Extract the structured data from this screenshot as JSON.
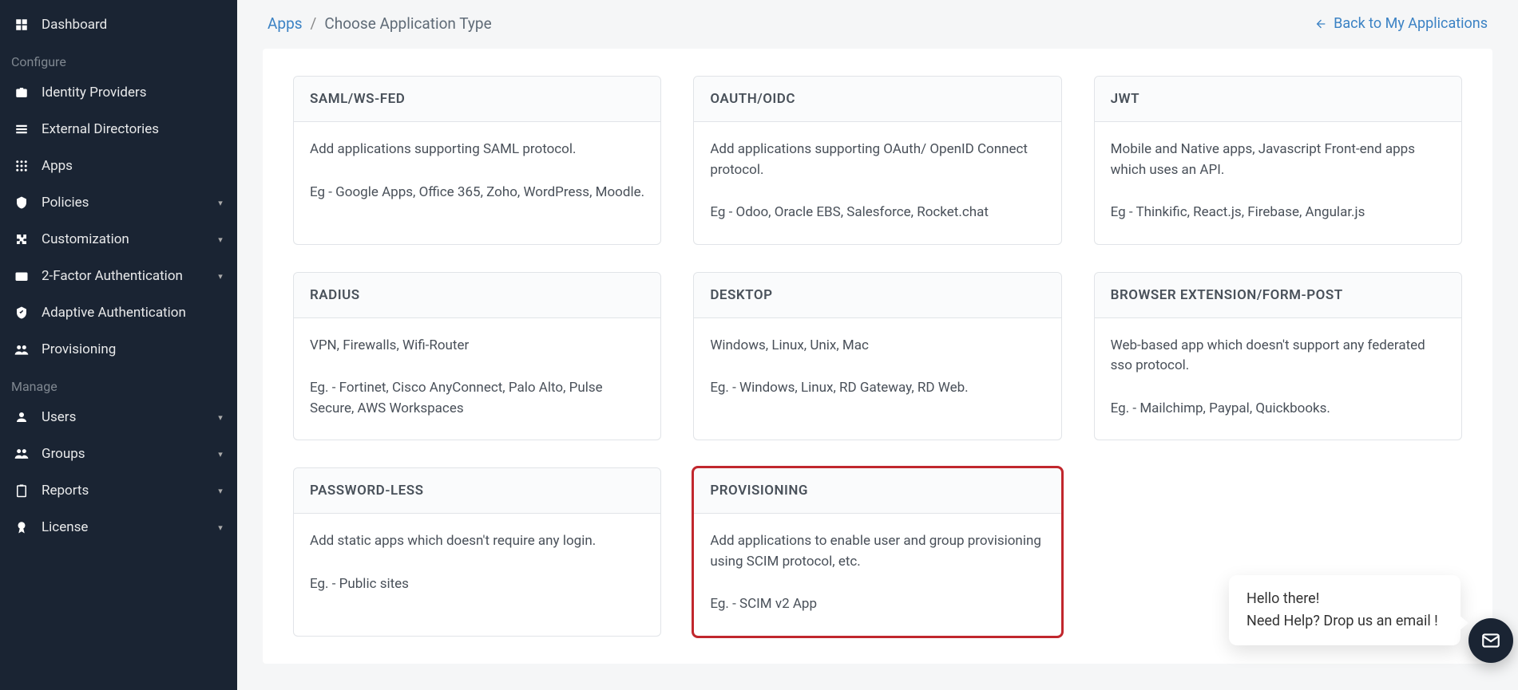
{
  "sidebar": {
    "items_top": [
      {
        "label": "Dashboard"
      }
    ],
    "section_configure": "Configure",
    "items_configure": [
      {
        "label": "Identity Providers",
        "expandable": false
      },
      {
        "label": "External Directories",
        "expandable": false
      },
      {
        "label": "Apps",
        "expandable": false
      },
      {
        "label": "Policies",
        "expandable": true
      },
      {
        "label": "Customization",
        "expandable": true
      },
      {
        "label": "2-Factor Authentication",
        "expandable": true
      },
      {
        "label": "Adaptive Authentication",
        "expandable": false
      },
      {
        "label": "Provisioning",
        "expandable": false
      }
    ],
    "section_manage": "Manage",
    "items_manage": [
      {
        "label": "Users",
        "expandable": true
      },
      {
        "label": "Groups",
        "expandable": true
      },
      {
        "label": "Reports",
        "expandable": true
      },
      {
        "label": "License",
        "expandable": true
      }
    ]
  },
  "breadcrumb": {
    "root": "Apps",
    "sep": "/",
    "current": "Choose Application Type"
  },
  "back_link": "Back to My Applications",
  "cards": [
    {
      "title": "SAML/WS-FED",
      "desc": "Add applications supporting SAML protocol.",
      "eg": "Eg - Google Apps, Office 365, Zoho, WordPress, Moodle."
    },
    {
      "title": "OAUTH/OIDC",
      "desc": "Add applications supporting OAuth/ OpenID Connect protocol.",
      "eg": "Eg - Odoo, Oracle EBS, Salesforce, Rocket.chat"
    },
    {
      "title": "JWT",
      "desc": "Mobile and Native apps, Javascript Front-end apps which uses an API.",
      "eg": "Eg - Thinkific, React.js, Firebase, Angular.js"
    },
    {
      "title": "RADIUS",
      "desc": "VPN, Firewalls, Wifi-Router",
      "eg": "Eg. - Fortinet, Cisco AnyConnect, Palo Alto, Pulse Secure, AWS Workspaces"
    },
    {
      "title": "DESKTOP",
      "desc": "Windows, Linux, Unix, Mac",
      "eg": "Eg. - Windows, Linux, RD Gateway, RD Web."
    },
    {
      "title": "BROWSER EXTENSION/FORM-POST",
      "desc": "Web-based app which doesn't support any federated sso protocol.",
      "eg": "Eg. - Mailchimp, Paypal, Quickbooks."
    },
    {
      "title": "PASSWORD-LESS",
      "desc": "Add static apps which doesn't require any login.",
      "eg": "Eg. - Public sites"
    },
    {
      "title": "PROVISIONING",
      "desc": "Add applications to enable user and group provisioning using SCIM protocol, etc.",
      "eg": "Eg. - SCIM v2 App",
      "highlight": true
    }
  ],
  "chat": {
    "line1": "Hello there!",
    "line2": "Need Help? Drop us an email !"
  }
}
